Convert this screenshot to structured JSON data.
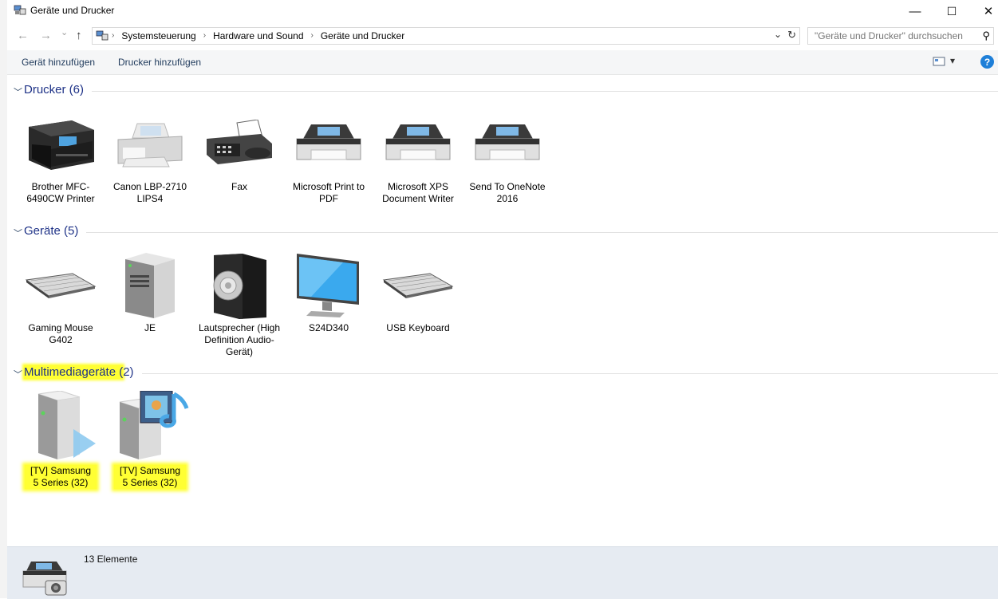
{
  "window": {
    "title": "Geräte und Drucker",
    "minimize": "—",
    "maximize": "☐",
    "close": "✕"
  },
  "nav": {
    "back": "←",
    "forward": "→",
    "recent": "⌄",
    "up": "↑",
    "breadcrumbs": [
      "Systemsteuerung",
      "Hardware und Sound",
      "Geräte und Drucker"
    ],
    "separator": "›",
    "dropdown": "⌄",
    "refresh": "↻",
    "search_placeholder": "\"Geräte und Drucker\" durchsuchen",
    "search_icon": "⚲"
  },
  "toolbar": {
    "add_device": "Gerät hinzufügen",
    "add_printer": "Drucker hinzufügen",
    "view_icon": "▾",
    "help": "?"
  },
  "groups": [
    {
      "title": "Drucker (6)",
      "items": [
        {
          "label": "Brother MFC-6490CW Printer",
          "icon": "mfc-printer-icon"
        },
        {
          "label": "Canon LBP-2710 LIPS4",
          "icon": "printer-icon"
        },
        {
          "label": "Fax",
          "icon": "fax-icon"
        },
        {
          "label": "Microsoft Print to PDF",
          "icon": "printer-icon"
        },
        {
          "label": "Microsoft XPS Document Writer",
          "icon": "printer-icon"
        },
        {
          "label": "Send To OneNote 2016",
          "icon": "printer-icon"
        }
      ]
    },
    {
      "title": "Geräte (5)",
      "items": [
        {
          "label": "Gaming Mouse G402",
          "icon": "keyboard-icon"
        },
        {
          "label": "JE",
          "icon": "computer-tower-icon"
        },
        {
          "label": "Lautsprecher (High Definition Audio-Gerät)",
          "icon": "speaker-icon"
        },
        {
          "label": "S24D340",
          "icon": "monitor-icon"
        },
        {
          "label": "USB Keyboard",
          "icon": "keyboard-icon"
        }
      ]
    },
    {
      "title_main": "Multimediageräte (",
      "title_rest": "2)",
      "items": [
        {
          "label": "[TV] Samsung 5 Series (32)",
          "icon": "media-renderer-icon"
        },
        {
          "label": "[TV] Samsung 5 Series (32)",
          "icon": "media-server-icon"
        }
      ]
    }
  ],
  "status": {
    "count": "13 Elemente"
  },
  "colors": {
    "highlight": "#ffff33",
    "group_title": "#1e3287",
    "status_bg": "#e6ebf2"
  }
}
